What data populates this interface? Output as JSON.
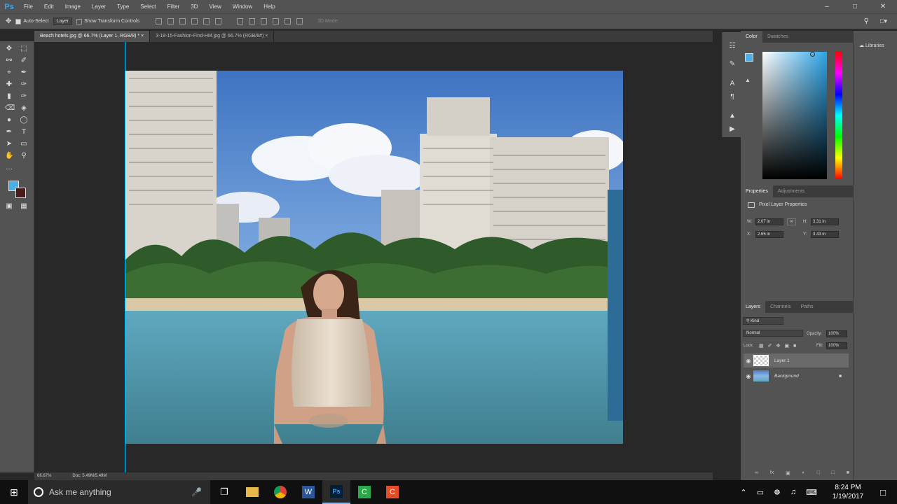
{
  "menubar": {
    "logo": "Ps",
    "items": [
      "File",
      "Edit",
      "Image",
      "Layer",
      "Type",
      "Select",
      "Filter",
      "3D",
      "View",
      "Window",
      "Help"
    ]
  },
  "options": {
    "auto_select": "Auto-Select",
    "layer_dropdown": "Layer",
    "transform_controls": "Show Transform Controls",
    "mode_3d": "3D Mode:"
  },
  "tabs": [
    {
      "label": "Beach hotels.jpg @ 66.7% (Layer 1, RGB/8) *"
    },
    {
      "label": "3-18-15-Fashion-Find-HM.jpg @ 66.7% (RGB/8#)"
    }
  ],
  "status": {
    "zoom": "66.67%",
    "doc": "Doc: 5.49M/5.49M"
  },
  "color_panel": {
    "tabs": [
      "Color",
      "Swatches"
    ],
    "fg": "#4ab1e8",
    "bg": "#4a1a18"
  },
  "properties": {
    "tabs": [
      "Properties",
      "Adjustments"
    ],
    "title": "Pixel Layer Properties",
    "w_label": "W:",
    "w": "2.07 in",
    "h_label": "H:",
    "h": "3.31 in",
    "x_label": "X:",
    "x": "2.65 in",
    "y_label": "Y:",
    "y": "3.43 in"
  },
  "layers": {
    "tabs": [
      "Layers",
      "Channels",
      "Paths"
    ],
    "kind": "Kind",
    "blend": "Normal",
    "opacity_label": "Opacity:",
    "opacity": "100%",
    "lock_label": "Lock:",
    "fill_label": "Fill:",
    "fill": "100%",
    "items": [
      {
        "name": "Layer 1"
      },
      {
        "name": "Background"
      }
    ]
  },
  "libraries": {
    "label": "Libraries"
  },
  "taskbar": {
    "search_placeholder": "Ask me anything",
    "time": "8:24 PM",
    "date": "1/19/2017"
  }
}
